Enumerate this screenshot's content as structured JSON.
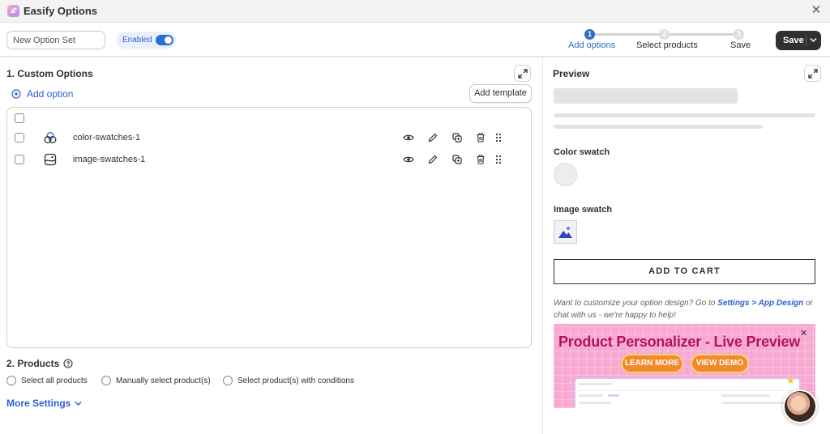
{
  "app": {
    "title": "Easify Options"
  },
  "header": {
    "name_placeholder": "New Option Set",
    "enabled_label": "Enabled",
    "steps": [
      {
        "number": "1",
        "label": "Add options"
      },
      {
        "number": "2",
        "label": "Select products"
      },
      {
        "number": "3",
        "label": "Save"
      }
    ],
    "save_label": "Save"
  },
  "custom_options": {
    "title": "1. Custom Options",
    "add_option_label": "Add option",
    "add_template_label": "Add template",
    "items": [
      {
        "name": "color-swatches-1",
        "icon": "color-swatch-icon"
      },
      {
        "name": "image-swatches-1",
        "icon": "image-swatch-icon"
      }
    ]
  },
  "products": {
    "title": "2. Products",
    "options": [
      "Select all products",
      "Manually select product(s)",
      "Select product(s) with conditions"
    ]
  },
  "more_settings_label": "More Settings",
  "preview": {
    "title": "Preview",
    "color_swatch_label": "Color swatch",
    "image_swatch_label": "Image swatch",
    "add_to_cart_label": "ADD TO CART",
    "help_text_1": "Want to customize your option design? Go to ",
    "help_link": "Settings > App Design",
    "help_text_2": " or chat with us - we're happy to help!",
    "promo": {
      "title": "Product Personalizer - Live Preview",
      "learn_more": "LEARN MORE",
      "view_demo": "VIEW DEMO"
    }
  },
  "colors": {
    "accent": "#2c6ecb",
    "primary_button": "#303030",
    "promo_bg": "#f7a9d2",
    "promo_title": "#b3125a",
    "promo_button": "#f28a2b"
  }
}
